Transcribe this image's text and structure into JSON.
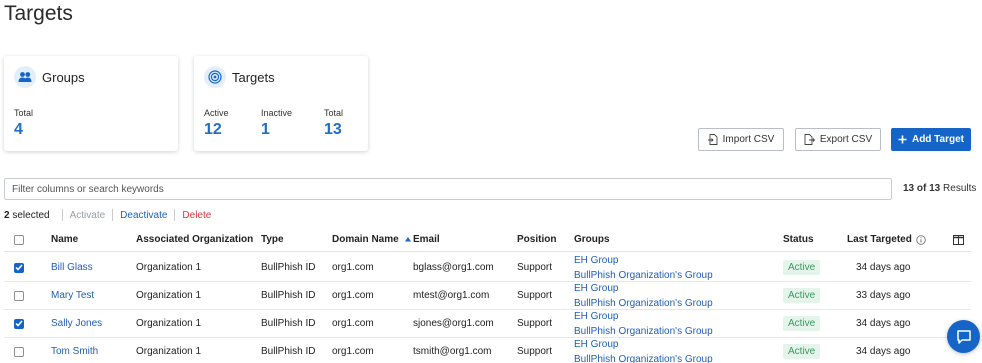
{
  "page": {
    "title": "Targets"
  },
  "cards": {
    "groups": {
      "title": "Groups",
      "icon": "people-icon",
      "total_label": "Total",
      "total_value": "4"
    },
    "targets": {
      "title": "Targets",
      "icon": "target-icon",
      "active_label": "Active",
      "active_value": "12",
      "inactive_label": "Inactive",
      "inactive_value": "1",
      "total_label": "Total",
      "total_value": "13"
    }
  },
  "toolbar": {
    "import_label": "Import CSV",
    "export_label": "Export CSV",
    "add_label": "Add Target"
  },
  "search": {
    "placeholder": "Filter columns or search keywords",
    "results_count": "13 of 13",
    "results_suffix": "Results"
  },
  "bulk": {
    "selected_count": "2",
    "selected_label": "selected",
    "activate": "Activate",
    "deactivate": "Deactivate",
    "delete": "Delete"
  },
  "table": {
    "columns": [
      "Name",
      "Associated Organization",
      "Type",
      "Domain Name",
      "Email",
      "Position",
      "Groups",
      "Status",
      "Last Targeted"
    ],
    "rows": [
      {
        "checked": true,
        "name": "Bill Glass",
        "org": "Organization 1",
        "type": "BullPhish ID",
        "domain": "org1.com",
        "email": "bglass@org1.com",
        "position": "Support",
        "groups": [
          "EH Group",
          "BullPhish Organization's Group"
        ],
        "status": "Active",
        "last": "34 days ago"
      },
      {
        "checked": false,
        "name": "Mary Test",
        "org": "Organization 1",
        "type": "BullPhish ID",
        "domain": "org1.com",
        "email": "mtest@org1.com",
        "position": "Support",
        "groups": [
          "EH Group",
          "BullPhish Organization's Group"
        ],
        "status": "Active",
        "last": "33 days ago"
      },
      {
        "checked": true,
        "name": "Sally Jones",
        "org": "Organization 1",
        "type": "BullPhish ID",
        "domain": "org1.com",
        "email": "sjones@org1.com",
        "position": "Support",
        "groups": [
          "EH Group",
          "BullPhish Organization's Group"
        ],
        "status": "Active",
        "last": "34 days ago"
      },
      {
        "checked": false,
        "name": "Tom Smith",
        "org": "Organization 1",
        "type": "BullPhish ID",
        "domain": "org1.com",
        "email": "tsmith@org1.com",
        "position": "Support",
        "groups": [
          "EH Group",
          "BullPhish Organization's Group"
        ],
        "status": "Active",
        "last": "34 days ago"
      }
    ]
  },
  "colors": {
    "accent": "#1565c9",
    "link": "#1f5fb5",
    "danger": "#d23a3a",
    "active_badge_bg": "#e4f4ea",
    "active_badge_text": "#3c9a5f"
  }
}
